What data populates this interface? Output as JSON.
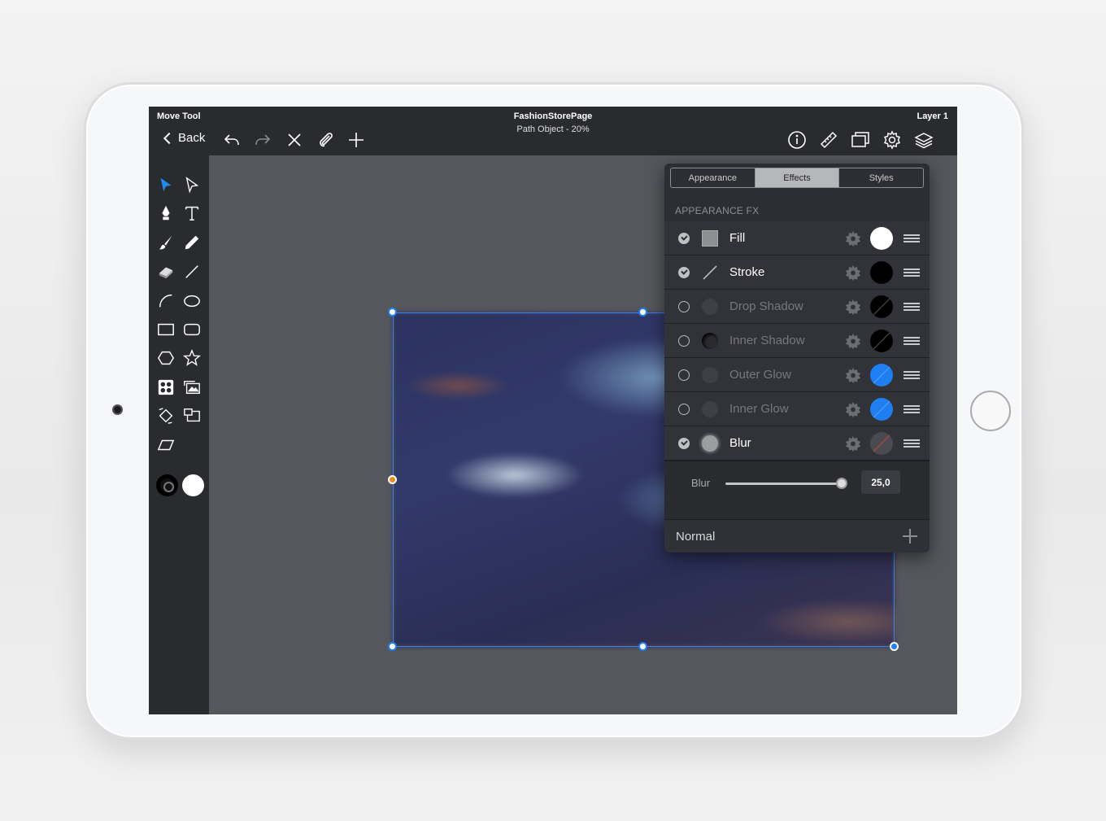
{
  "header": {
    "current_tool": "Move Tool",
    "document_title": "FashionStorePage",
    "document_subtitle": "Path Object - 20%",
    "layer_name": "Layer 1",
    "back_label": "Back"
  },
  "toolbar_icons": [
    "undo-icon",
    "redo-icon",
    "close-icon",
    "paperclip-icon",
    "plus-icon",
    "info-icon",
    "ruler-icon",
    "artboard-icon",
    "gear-icon",
    "layers-icon"
  ],
  "tools": [
    "select",
    "direct-select",
    "pen",
    "text",
    "brush",
    "pencil",
    "eraser",
    "line",
    "arc",
    "ellipse",
    "rectangle",
    "rounded-rectangle",
    "polygon",
    "star",
    "image",
    "picture-frame",
    "transform",
    "artboard",
    "skew"
  ],
  "popover": {
    "tabs": [
      {
        "label": "Appearance",
        "active": false
      },
      {
        "label": "Effects",
        "active": true
      },
      {
        "label": "Styles",
        "active": false
      }
    ],
    "section_label": "APPEARANCE FX",
    "effects": [
      {
        "name": "Fill",
        "enabled": true,
        "color": "#ffffff"
      },
      {
        "name": "Stroke",
        "enabled": true,
        "color": "#000000"
      },
      {
        "name": "Drop Shadow",
        "enabled": false,
        "color": "#000000"
      },
      {
        "name": "Inner Shadow",
        "enabled": false,
        "color": "#000000"
      },
      {
        "name": "Outer Glow",
        "enabled": false,
        "color": "#1e7ff2"
      },
      {
        "name": "Inner Glow",
        "enabled": false,
        "color": "#1e7ff2"
      },
      {
        "name": "Blur",
        "enabled": true,
        "color": "#555555"
      }
    ],
    "blur": {
      "label": "Blur",
      "value": "25,0",
      "slider_fraction": 1.0
    },
    "blend_mode": "Normal"
  },
  "colors": {
    "accent": "#1e7ff2",
    "selection_orange": "#f08a1e",
    "stroke_color": "#000000",
    "fill_color": "#ffffff"
  }
}
